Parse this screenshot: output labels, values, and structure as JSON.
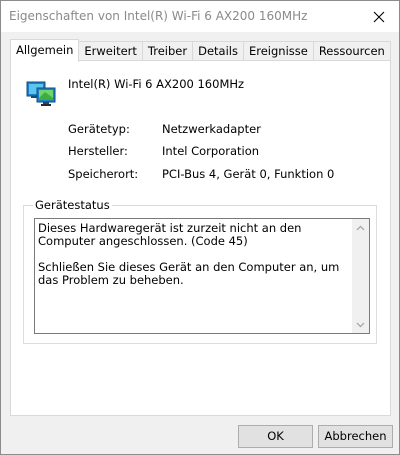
{
  "window": {
    "title": "Eigenschaften von Intel(R) Wi-Fi 6 AX200 160MHz"
  },
  "tabs": [
    {
      "label": "Allgemein",
      "active": true
    },
    {
      "label": "Erweitert",
      "active": false
    },
    {
      "label": "Treiber",
      "active": false
    },
    {
      "label": "Details",
      "active": false
    },
    {
      "label": "Ereignisse",
      "active": false
    },
    {
      "label": "Ressourcen",
      "active": false
    }
  ],
  "general": {
    "device_icon": "network-adapter-icon",
    "device_name": "Intel(R) Wi-Fi 6 AX200 160MHz",
    "properties": [
      {
        "label": "Gerätetyp:",
        "value": "Netzwerkadapter"
      },
      {
        "label": "Hersteller:",
        "value": "Intel Corporation"
      },
      {
        "label": "Speicherort:",
        "value": "PCI-Bus 4, Gerät 0, Funktion 0"
      }
    ],
    "status_group_title": "Gerätestatus",
    "status_lines": [
      "Dieses Hardwaregerät ist zurzeit nicht an den Computer angeschlossen. (Code 45)",
      "Schließen Sie dieses Gerät an den Computer an, um das Problem zu beheben."
    ]
  },
  "buttons": {
    "ok": "OK",
    "cancel": "Abbrechen"
  },
  "colors": {
    "title_text": "#8a8a8a",
    "window_bg": "#f0f0f0",
    "panel_bg": "#ffffff",
    "button_bg": "#e1e1e1"
  }
}
